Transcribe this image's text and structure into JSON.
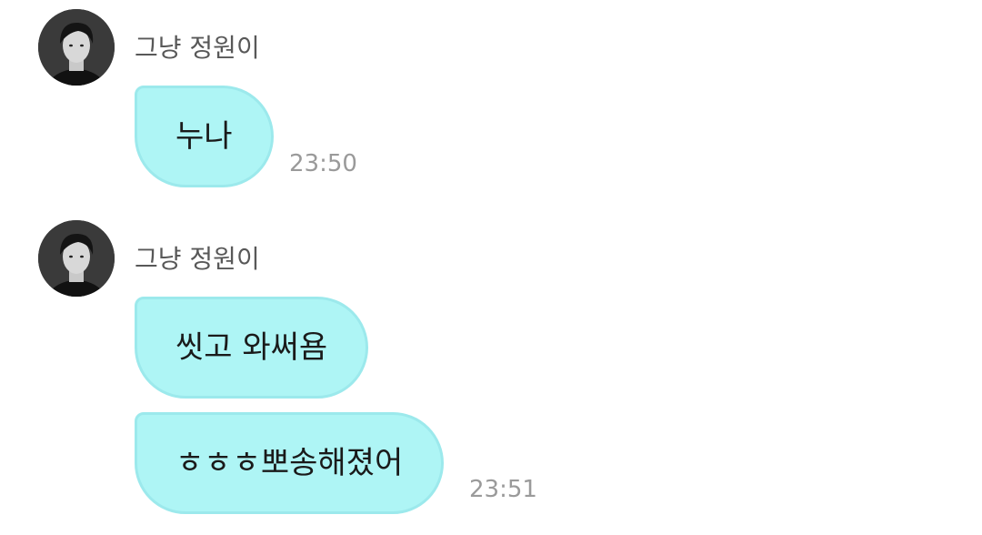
{
  "conversation": {
    "groups": [
      {
        "sender": "그냥 정원이",
        "avatar_icon": "profile-photo-avatar",
        "messages": [
          {
            "text": "누나",
            "time": "23:50"
          }
        ]
      },
      {
        "sender": "그냥 정원이",
        "avatar_icon": "profile-photo-avatar",
        "messages": [
          {
            "text": "씻고 와써욤",
            "time": ""
          },
          {
            "text": "ㅎㅎㅎ뽀송해졌어",
            "time": "23:51"
          }
        ]
      }
    ]
  },
  "colors": {
    "bubble_background": "#aef5f5",
    "bubble_border": "#9ce9ec",
    "sender_name": "#585858",
    "timestamp": "#9a9a9a",
    "message_text": "#1a1a1a"
  }
}
